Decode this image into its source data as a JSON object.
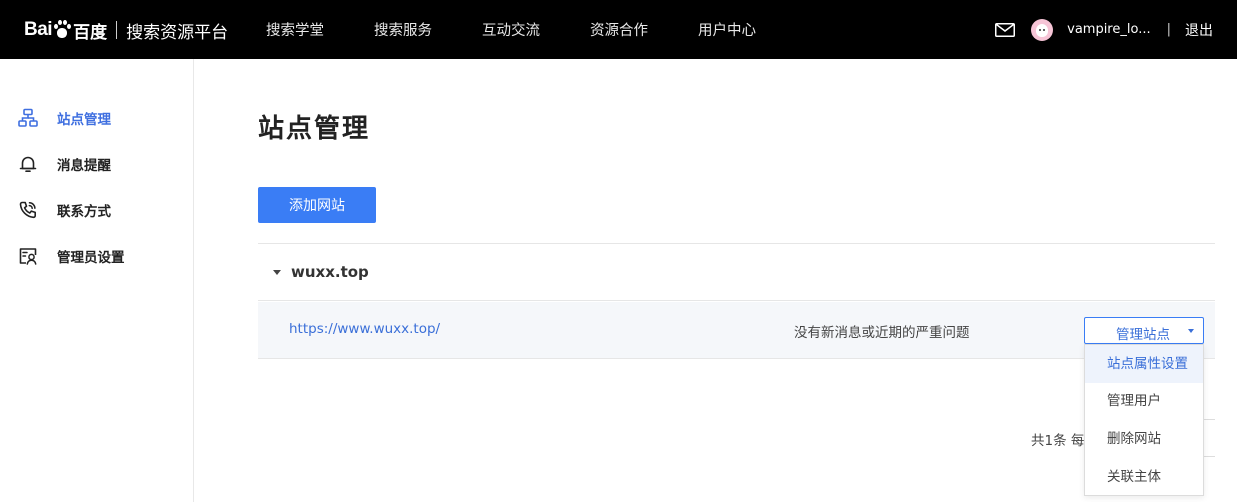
{
  "header": {
    "logo_text": "Bai",
    "logo_cn": "百度",
    "platform_title": "搜索资源平台",
    "nav": [
      "搜索学堂",
      "搜索服务",
      "互动交流",
      "资源合作",
      "用户中心"
    ],
    "username": "vampire_lo...",
    "separator": "|",
    "logout": "退出"
  },
  "sidebar": {
    "items": [
      {
        "label": "站点管理",
        "icon": "sitemap-icon",
        "active": true
      },
      {
        "label": "消息提醒",
        "icon": "bell-icon",
        "active": false
      },
      {
        "label": "联系方式",
        "icon": "phone-icon",
        "active": false
      },
      {
        "label": "管理员设置",
        "icon": "admin-card-icon",
        "active": false
      }
    ]
  },
  "main": {
    "title": "站点管理",
    "add_button": "添加网站",
    "group": {
      "name": "wuxx.top",
      "site": {
        "url": "https://www.wuxx.top/",
        "status": "没有新消息或近期的严重问题",
        "manage_label": "管理站点"
      }
    },
    "pager_text": "共1条  每"
  },
  "dropdown": {
    "items": [
      "站点属性设置",
      "管理用户",
      "删除网站",
      "关联主体"
    ],
    "hover_index": 0
  },
  "colors": {
    "accent": "#3a7df5",
    "link": "#3a6fd8",
    "topbar": "#000000",
    "row_bg": "#f5f7fa"
  }
}
